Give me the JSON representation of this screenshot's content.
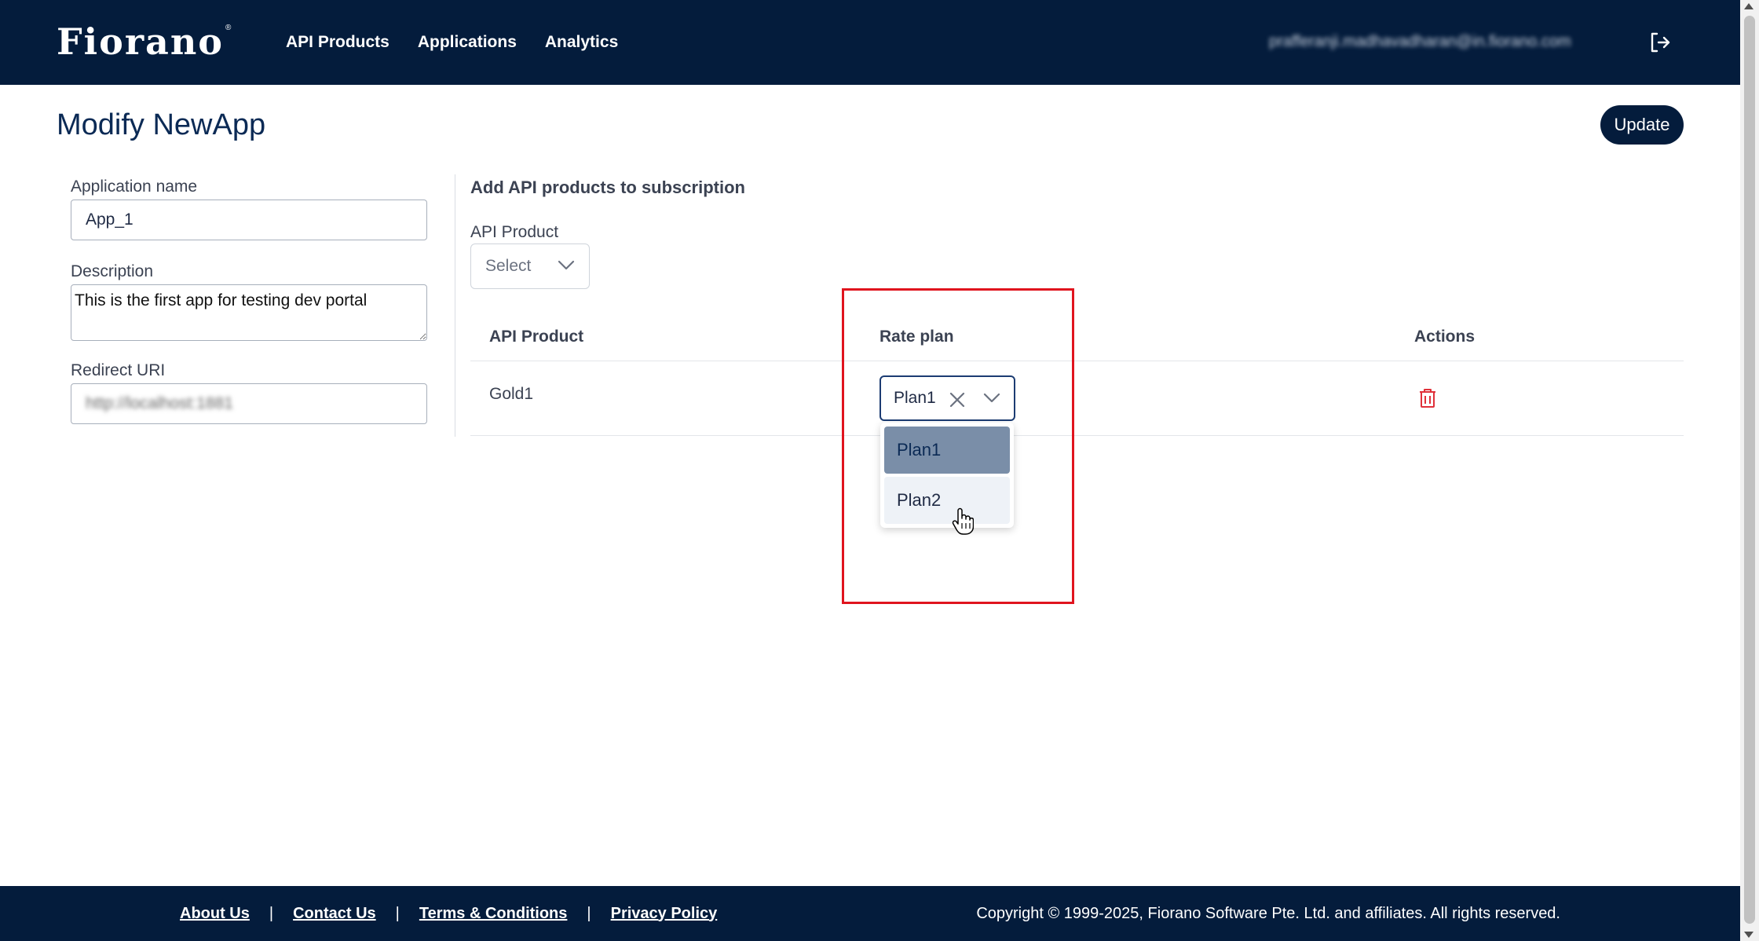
{
  "header": {
    "logo": "Fiorano",
    "logo_tm": "®",
    "nav": [
      {
        "label": "API Products"
      },
      {
        "label": "Applications"
      },
      {
        "label": "Analytics"
      }
    ],
    "user_email": "prafferanji.madhavadharan@in.fiorano.com",
    "icons": {
      "logout": "logout-icon"
    }
  },
  "page": {
    "title": "Modify NewApp",
    "update_label": "Update"
  },
  "form": {
    "app_name_label": "Application name",
    "app_name_value": "App_1",
    "description_label": "Description",
    "description_value": "This is the first app for testing dev portal",
    "redirect_label": "Redirect URI",
    "redirect_value": "http://localhost:1881"
  },
  "subscription": {
    "section_title": "Add API products to subscription",
    "api_product_label": "API Product",
    "select_placeholder": "Select",
    "table": {
      "headers": [
        "API Product",
        "Rate plan",
        "Actions"
      ],
      "rows": [
        {
          "product": "Gold1",
          "rate_plan": "Plan1"
        }
      ]
    },
    "rate_plan_options": [
      "Plan1",
      "Plan2"
    ],
    "selected_option": "Plan1",
    "hovered_option": "Plan2"
  },
  "footer": {
    "links": [
      "About Us",
      "Contact Us",
      "Terms & Conditions",
      "Privacy Policy"
    ],
    "separator": "|",
    "copyright": "Copyright © 1999-2025, Fiorano Software Pte. Ltd. and affiliates. All rights reserved."
  },
  "colors": {
    "brand_navy": "#041c3c",
    "highlight_red": "#e0141e",
    "delete_red": "#e0313a",
    "selected_option_bg": "#7a8ea8"
  }
}
